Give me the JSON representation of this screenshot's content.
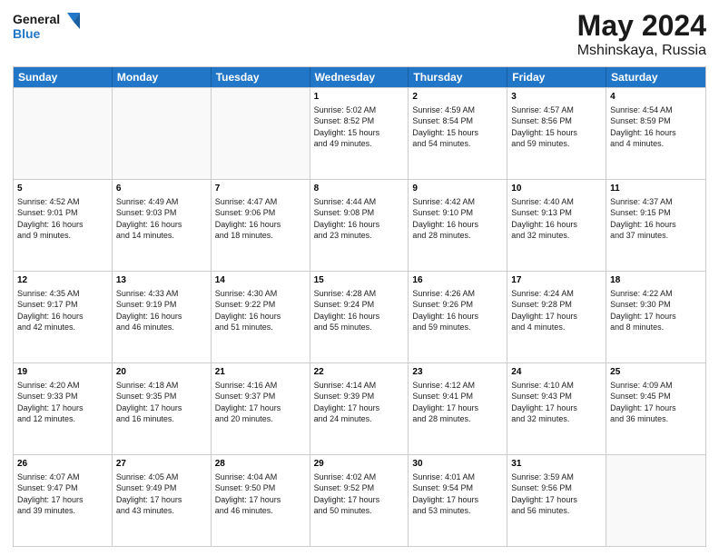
{
  "header": {
    "logo_line1": "General",
    "logo_line2": "Blue",
    "title": "May 2024",
    "location": "Mshinskaya, Russia"
  },
  "weekdays": [
    "Sunday",
    "Monday",
    "Tuesday",
    "Wednesday",
    "Thursday",
    "Friday",
    "Saturday"
  ],
  "weeks": [
    [
      {
        "day": "",
        "info": ""
      },
      {
        "day": "",
        "info": ""
      },
      {
        "day": "",
        "info": ""
      },
      {
        "day": "1",
        "info": "Sunrise: 5:02 AM\nSunset: 8:52 PM\nDaylight: 15 hours\nand 49 minutes."
      },
      {
        "day": "2",
        "info": "Sunrise: 4:59 AM\nSunset: 8:54 PM\nDaylight: 15 hours\nand 54 minutes."
      },
      {
        "day": "3",
        "info": "Sunrise: 4:57 AM\nSunset: 8:56 PM\nDaylight: 15 hours\nand 59 minutes."
      },
      {
        "day": "4",
        "info": "Sunrise: 4:54 AM\nSunset: 8:59 PM\nDaylight: 16 hours\nand 4 minutes."
      }
    ],
    [
      {
        "day": "5",
        "info": "Sunrise: 4:52 AM\nSunset: 9:01 PM\nDaylight: 16 hours\nand 9 minutes."
      },
      {
        "day": "6",
        "info": "Sunrise: 4:49 AM\nSunset: 9:03 PM\nDaylight: 16 hours\nand 14 minutes."
      },
      {
        "day": "7",
        "info": "Sunrise: 4:47 AM\nSunset: 9:06 PM\nDaylight: 16 hours\nand 18 minutes."
      },
      {
        "day": "8",
        "info": "Sunrise: 4:44 AM\nSunset: 9:08 PM\nDaylight: 16 hours\nand 23 minutes."
      },
      {
        "day": "9",
        "info": "Sunrise: 4:42 AM\nSunset: 9:10 PM\nDaylight: 16 hours\nand 28 minutes."
      },
      {
        "day": "10",
        "info": "Sunrise: 4:40 AM\nSunset: 9:13 PM\nDaylight: 16 hours\nand 32 minutes."
      },
      {
        "day": "11",
        "info": "Sunrise: 4:37 AM\nSunset: 9:15 PM\nDaylight: 16 hours\nand 37 minutes."
      }
    ],
    [
      {
        "day": "12",
        "info": "Sunrise: 4:35 AM\nSunset: 9:17 PM\nDaylight: 16 hours\nand 42 minutes."
      },
      {
        "day": "13",
        "info": "Sunrise: 4:33 AM\nSunset: 9:19 PM\nDaylight: 16 hours\nand 46 minutes."
      },
      {
        "day": "14",
        "info": "Sunrise: 4:30 AM\nSunset: 9:22 PM\nDaylight: 16 hours\nand 51 minutes."
      },
      {
        "day": "15",
        "info": "Sunrise: 4:28 AM\nSunset: 9:24 PM\nDaylight: 16 hours\nand 55 minutes."
      },
      {
        "day": "16",
        "info": "Sunrise: 4:26 AM\nSunset: 9:26 PM\nDaylight: 16 hours\nand 59 minutes."
      },
      {
        "day": "17",
        "info": "Sunrise: 4:24 AM\nSunset: 9:28 PM\nDaylight: 17 hours\nand 4 minutes."
      },
      {
        "day": "18",
        "info": "Sunrise: 4:22 AM\nSunset: 9:30 PM\nDaylight: 17 hours\nand 8 minutes."
      }
    ],
    [
      {
        "day": "19",
        "info": "Sunrise: 4:20 AM\nSunset: 9:33 PM\nDaylight: 17 hours\nand 12 minutes."
      },
      {
        "day": "20",
        "info": "Sunrise: 4:18 AM\nSunset: 9:35 PM\nDaylight: 17 hours\nand 16 minutes."
      },
      {
        "day": "21",
        "info": "Sunrise: 4:16 AM\nSunset: 9:37 PM\nDaylight: 17 hours\nand 20 minutes."
      },
      {
        "day": "22",
        "info": "Sunrise: 4:14 AM\nSunset: 9:39 PM\nDaylight: 17 hours\nand 24 minutes."
      },
      {
        "day": "23",
        "info": "Sunrise: 4:12 AM\nSunset: 9:41 PM\nDaylight: 17 hours\nand 28 minutes."
      },
      {
        "day": "24",
        "info": "Sunrise: 4:10 AM\nSunset: 9:43 PM\nDaylight: 17 hours\nand 32 minutes."
      },
      {
        "day": "25",
        "info": "Sunrise: 4:09 AM\nSunset: 9:45 PM\nDaylight: 17 hours\nand 36 minutes."
      }
    ],
    [
      {
        "day": "26",
        "info": "Sunrise: 4:07 AM\nSunset: 9:47 PM\nDaylight: 17 hours\nand 39 minutes."
      },
      {
        "day": "27",
        "info": "Sunrise: 4:05 AM\nSunset: 9:49 PM\nDaylight: 17 hours\nand 43 minutes."
      },
      {
        "day": "28",
        "info": "Sunrise: 4:04 AM\nSunset: 9:50 PM\nDaylight: 17 hours\nand 46 minutes."
      },
      {
        "day": "29",
        "info": "Sunrise: 4:02 AM\nSunset: 9:52 PM\nDaylight: 17 hours\nand 50 minutes."
      },
      {
        "day": "30",
        "info": "Sunrise: 4:01 AM\nSunset: 9:54 PM\nDaylight: 17 hours\nand 53 minutes."
      },
      {
        "day": "31",
        "info": "Sunrise: 3:59 AM\nSunset: 9:56 PM\nDaylight: 17 hours\nand 56 minutes."
      },
      {
        "day": "",
        "info": ""
      }
    ]
  ]
}
